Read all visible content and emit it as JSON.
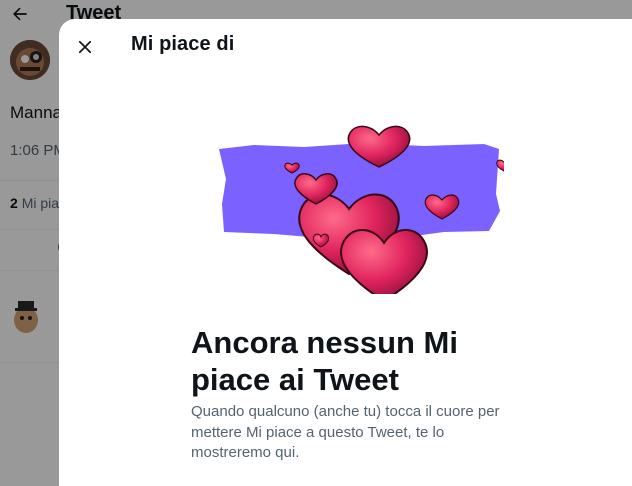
{
  "background": {
    "header_title": "Tweet",
    "author_name_partial": "Manna",
    "timestamp_partial": "1:06 PM",
    "likes_count": "2",
    "likes_label_partial": "Mi piac"
  },
  "modal": {
    "title": "Mi piace di",
    "empty_title": "Ancora nessun Mi piace ai Tweet",
    "empty_description": "Quando qualcuno (anche tu) tocca il cuore per mettere Mi piace a questo Tweet, te lo mostreremo qui."
  },
  "colors": {
    "accent_purple": "#7b61ff",
    "heart_red": "#e0245e",
    "text_primary": "#0f1419",
    "text_secondary": "#536471"
  },
  "icons": {
    "back": "arrow-left-icon",
    "close": "close-icon",
    "illustration": "hearts-illustration"
  }
}
